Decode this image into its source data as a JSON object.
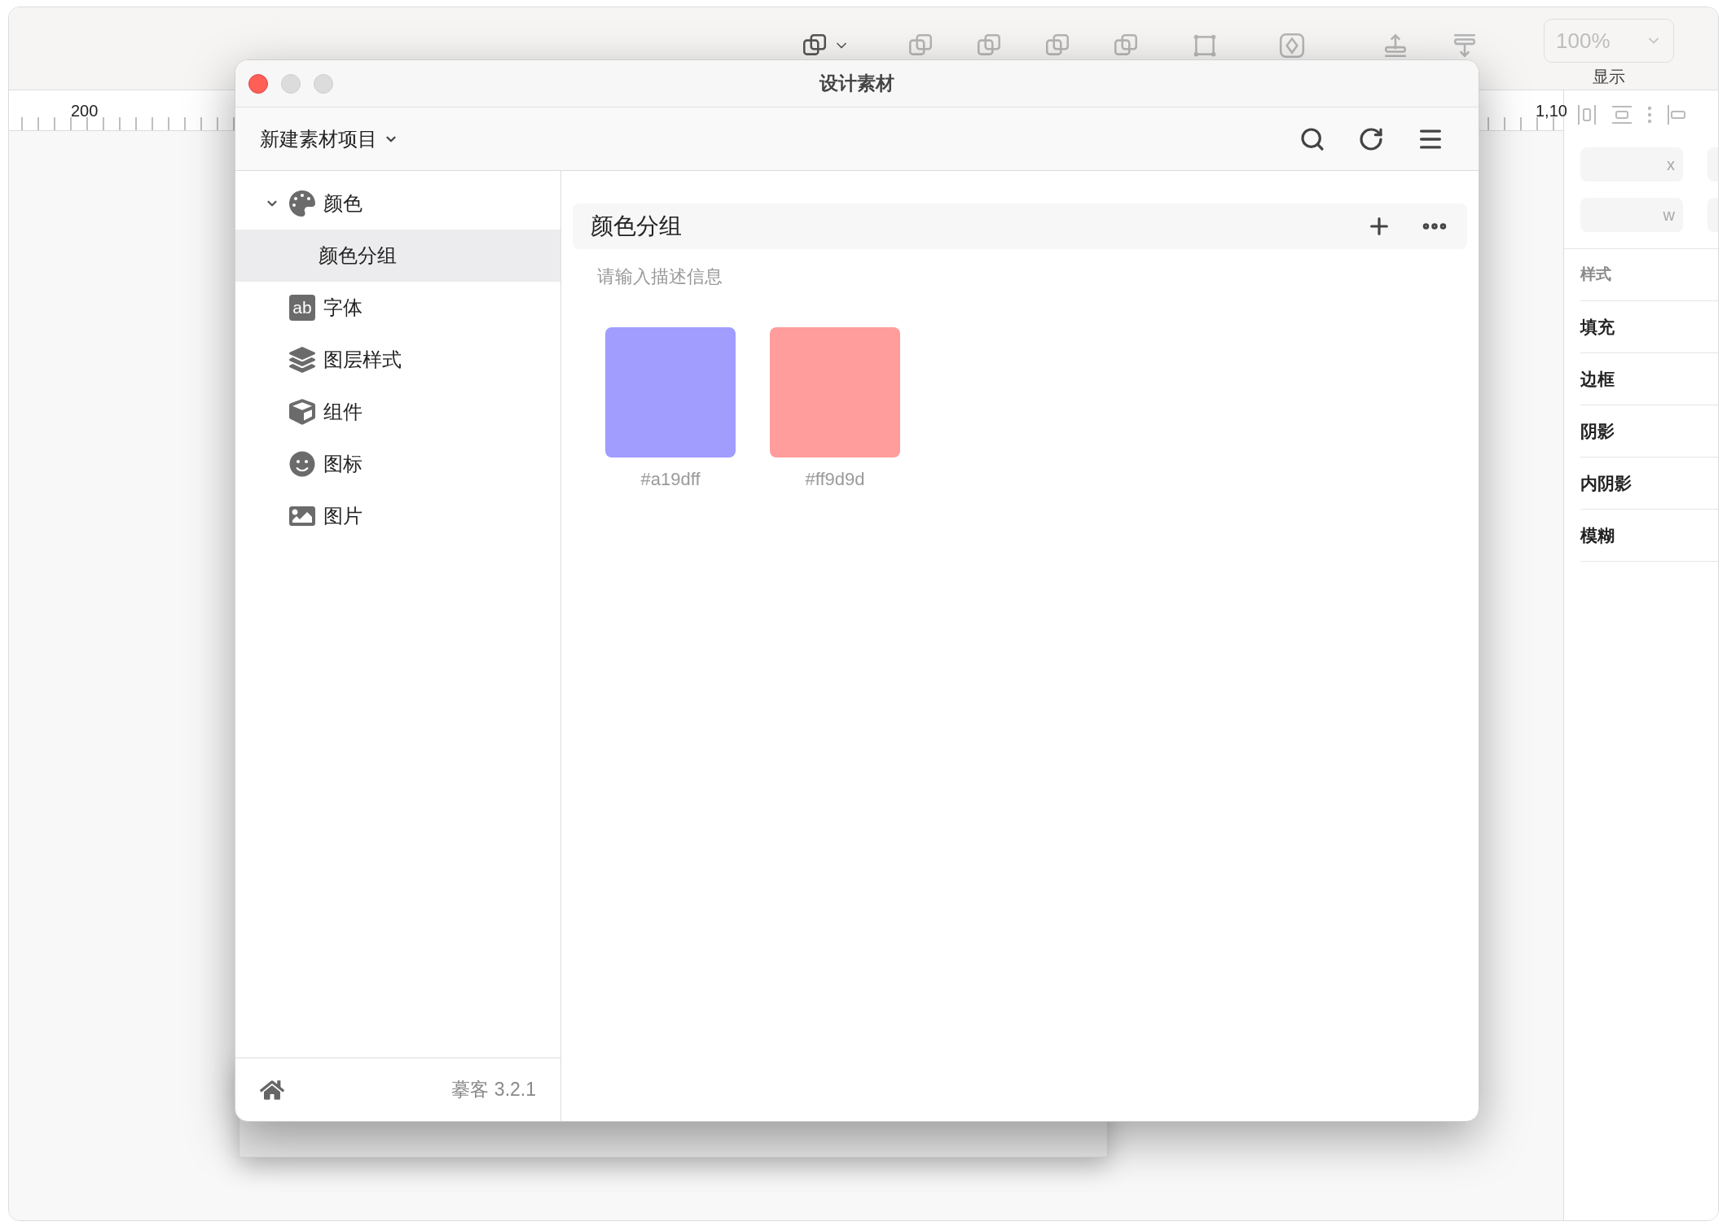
{
  "toolbar": {
    "zoom": "100%",
    "zoom_label": "显示"
  },
  "ruler": {
    "labels": [
      "200",
      "1,10"
    ]
  },
  "inspector": {
    "fields": [
      {
        "placeholder": "x"
      },
      {
        "placeholder": "w"
      }
    ],
    "section_title": "样式",
    "sections": [
      "填充",
      "边框",
      "阴影",
      "内阴影",
      "模糊"
    ]
  },
  "dialog": {
    "title": "设计素材",
    "project": "新建素材项目",
    "sidebar": {
      "items": [
        {
          "label": "颜色",
          "kind": "palette",
          "expanded": true,
          "selected": false,
          "children": [
            {
              "label": "颜色分组",
              "selected": true
            }
          ]
        },
        {
          "label": "字体",
          "kind": "badge",
          "badge": "ab",
          "selected": false
        },
        {
          "label": "图层样式",
          "kind": "layers",
          "selected": false
        },
        {
          "label": "组件",
          "kind": "cube",
          "selected": false
        },
        {
          "label": "图标",
          "kind": "smile",
          "selected": false
        },
        {
          "label": "图片",
          "kind": "image",
          "selected": false
        }
      ]
    },
    "footer": {
      "version": "摹客 3.2.1"
    },
    "group": {
      "title": "颜色分组",
      "description_placeholder": "请输入描述信息",
      "swatches": [
        {
          "color": "#a19dff",
          "label": "#a19dff"
        },
        {
          "color": "#ff9d9d",
          "label": "#ff9d9d"
        }
      ]
    }
  }
}
